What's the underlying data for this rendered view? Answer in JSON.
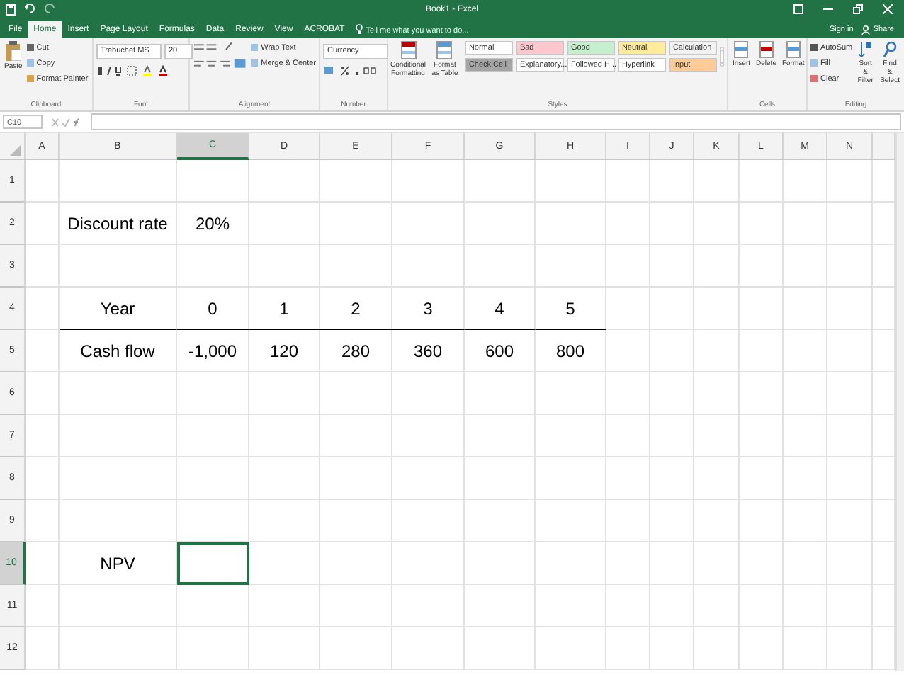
{
  "window": {
    "title": "Book1 - Excel",
    "sign_in": "Sign in",
    "share": "Share"
  },
  "tabs": [
    {
      "label": "File",
      "selected": false
    },
    {
      "label": "Home",
      "selected": true
    },
    {
      "label": "Insert",
      "selected": false
    },
    {
      "label": "Page Layout",
      "selected": false
    },
    {
      "label": "Formulas",
      "selected": false
    },
    {
      "label": "Data",
      "selected": false
    },
    {
      "label": "Review",
      "selected": false
    },
    {
      "label": "View",
      "selected": false
    },
    {
      "label": "ACROBAT",
      "selected": false
    }
  ],
  "tell_me": {
    "placeholder": "Tell me what you want to do..."
  },
  "ribbon": {
    "clipboard": {
      "name": "Clipboard",
      "paste": "Paste",
      "small": [
        "Cut",
        "Copy",
        "Format Painter"
      ]
    },
    "font": {
      "name": "Font",
      "font": "Trebuchet MS",
      "size": "20"
    },
    "alignment": {
      "name": "Alignment",
      "small": [
        "Wrap Text",
        "Merge & Center"
      ]
    },
    "number": {
      "name": "Number",
      "format": "Currency"
    },
    "styles": {
      "name": "Styles",
      "large": [
        "Conditional Formatting",
        "Format as Table"
      ],
      "cell_styles": [
        {
          "label": "Normal",
          "color": "#ffffff"
        },
        {
          "label": "Bad",
          "color": "#ffc7ce"
        },
        {
          "label": "Good",
          "color": "#c6efce"
        },
        {
          "label": "Neutral",
          "color": "#ffeb9c"
        },
        {
          "label": "Calculation",
          "color": "#f2f2f2"
        },
        {
          "label": "Check Cell",
          "color": "#a5a5a5"
        },
        {
          "label": "Explanatory...",
          "color": "#ffffff"
        },
        {
          "label": "Followed H...",
          "color": "#ffffff"
        },
        {
          "label": "Hyperlink",
          "color": "#ffffff"
        },
        {
          "label": "Input",
          "color": "#ffcc99"
        }
      ]
    },
    "cells": {
      "name": "Cells",
      "large": [
        "Insert",
        "Delete",
        "Format"
      ]
    },
    "editing": {
      "name": "Editing",
      "small": [
        "AutoSum",
        "Fill",
        "Clear"
      ],
      "large": [
        "Sort & Filter",
        "Find & Select"
      ]
    }
  },
  "name_box": "C10",
  "columns": [
    {
      "label": "A",
      "selected": false
    },
    {
      "label": "B",
      "selected": false
    },
    {
      "label": "C",
      "selected": true
    },
    {
      "label": "D",
      "selected": false
    },
    {
      "label": "E",
      "selected": false
    },
    {
      "label": "F",
      "selected": false
    },
    {
      "label": "G",
      "selected": false
    },
    {
      "label": "H",
      "selected": false
    },
    {
      "label": "I",
      "selected": false
    },
    {
      "label": "J",
      "selected": false
    },
    {
      "label": "K",
      "selected": false
    },
    {
      "label": "L",
      "selected": false
    },
    {
      "label": "M",
      "selected": false
    },
    {
      "label": "N",
      "selected": false
    }
  ],
  "rows": [
    {
      "header": "1",
      "selected": false,
      "cells": []
    },
    {
      "header": "2",
      "selected": false,
      "cells": [
        {
          "text": "Discount rate",
          "bordered": false
        },
        {
          "text": "20%",
          "bordered": false
        }
      ]
    },
    {
      "header": "3",
      "selected": false,
      "cells": []
    },
    {
      "header": "4",
      "selected": false,
      "cells": [
        {
          "text": "Year",
          "bordered": true
        },
        {
          "text": "0",
          "bordered": true
        },
        {
          "text": "1",
          "bordered": true
        },
        {
          "text": "2",
          "bordered": true
        },
        {
          "text": "3",
          "bordered": true
        },
        {
          "text": "4",
          "bordered": true
        },
        {
          "text": "5",
          "bordered": true
        }
      ]
    },
    {
      "header": "5",
      "selected": false,
      "cells": [
        {
          "text": "Cash flow",
          "bordered": false
        },
        {
          "text": "-1,000",
          "bordered": false
        },
        {
          "text": "120",
          "bordered": false
        },
        {
          "text": "280",
          "bordered": false
        },
        {
          "text": "360",
          "bordered": false
        },
        {
          "text": "600",
          "bordered": false
        },
        {
          "text": "800",
          "bordered": false
        }
      ]
    },
    {
      "header": "6",
      "selected": false,
      "cells": []
    },
    {
      "header": "7",
      "selected": false,
      "cells": []
    },
    {
      "header": "8",
      "selected": false,
      "cells": []
    },
    {
      "header": "9",
      "selected": false,
      "cells": []
    },
    {
      "header": "10",
      "selected": true,
      "cells": [
        {
          "text": "NPV",
          "bordered": false
        },
        {
          "active": true
        }
      ]
    },
    {
      "header": "11",
      "selected": false,
      "cells": []
    },
    {
      "header": "12",
      "selected": false,
      "cells": []
    }
  ]
}
